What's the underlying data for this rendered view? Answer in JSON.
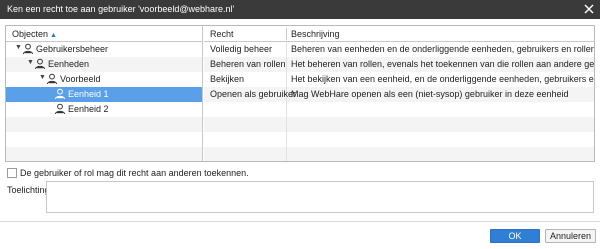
{
  "dialog": {
    "title": "Ken een recht toe aan gebruiker 'voorbeeld@webhare.nl'"
  },
  "objects": {
    "header": "Objecten",
    "sort_indicator": "▲",
    "tree": [
      {
        "label": "Gebruikersbeheer",
        "toggle": "▼",
        "icon": "users-icon",
        "selected": false
      },
      {
        "label": "Eenheden",
        "toggle": "▼",
        "icon": "units-icon",
        "selected": false
      },
      {
        "label": "Voorbeeld",
        "toggle": "▼",
        "icon": "unit-icon",
        "selected": false
      },
      {
        "label": "Eenheid 1",
        "toggle": "",
        "icon": "unit-icon",
        "selected": true
      },
      {
        "label": "Eenheid 2",
        "toggle": "",
        "icon": "unit-icon",
        "selected": false
      }
    ]
  },
  "rights": {
    "columns": {
      "right": "Recht",
      "description": "Beschrijving"
    },
    "rows": [
      {
        "right": "Volledig beheer",
        "description": "Beheren van eenheden en de onderliggende eenheden, gebruikers en rollen"
      },
      {
        "right": "Beheren van rollen",
        "description": "Het beheren van rollen, evenals het toekennen van die rollen aan andere gebruikers"
      },
      {
        "right": "Bekijken",
        "description": "Het bekijken van een eenheid, en de onderliggende eenheden, gebruikers en rollen"
      },
      {
        "right": "Openen als gebruiker",
        "description": "Mag WebHare openen als een (niet-sysop) gebruiker in deze eenheid"
      }
    ]
  },
  "grant_option": {
    "label": "De gebruiker of rol mag dit recht aan anderen toekennen.",
    "checked": false
  },
  "explanation": {
    "label": "Toelichting:",
    "value": ""
  },
  "buttons": {
    "ok": "OK",
    "cancel": "Annuleren"
  },
  "colors": {
    "titlebar": "#3a3a3a",
    "selection": "#5aa0e8",
    "primary_button": "#2f7fd6"
  }
}
